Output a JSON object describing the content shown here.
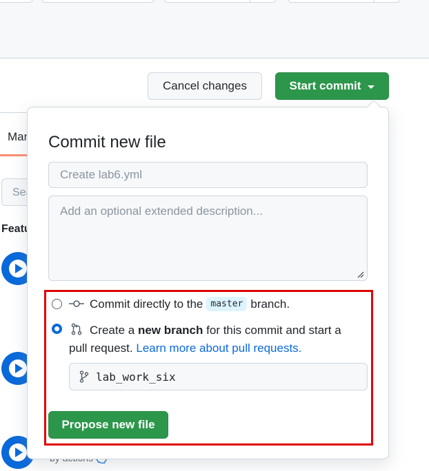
{
  "header": {
    "cancel_label": "Cancel changes",
    "start_commit_label": "Start commit"
  },
  "background": {
    "tab_label": "Man",
    "search_placeholder": "Sea",
    "section_label": "Featu",
    "by_actions": "by actions"
  },
  "commit_dialog": {
    "title": "Commit new file",
    "summary_placeholder": "Create lab6.yml",
    "description_placeholder": "Add an optional extended description...",
    "option_direct": {
      "prefix": "Commit directly to the",
      "branch": "master",
      "suffix": "branch."
    },
    "option_new_branch": {
      "prefix": "Create a",
      "bold": "new branch",
      "suffix": "for this commit and start a",
      "line2": "pull request.",
      "link": "Learn more about pull requests."
    },
    "selected_option": "new_branch",
    "branch_name": "lab_work_six",
    "propose_label": "Propose new file"
  },
  "colors": {
    "primary_green": "#2c974b",
    "link_blue": "#0969da",
    "highlight_red": "#e00000"
  }
}
